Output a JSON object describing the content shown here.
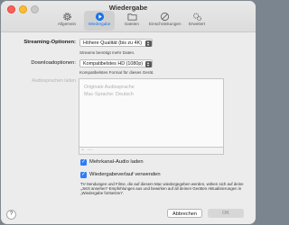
{
  "window": {
    "title": "Wiedergabe"
  },
  "toolbar": {
    "items": [
      {
        "label": "Allgemein",
        "icon": "gear-icon"
      },
      {
        "label": "Wiedergabe",
        "icon": "play-icon",
        "active": true
      },
      {
        "label": "Dateien",
        "icon": "folder-icon"
      },
      {
        "label": "Einschränkungen",
        "icon": "restrictions-icon"
      },
      {
        "label": "Erweitert",
        "icon": "advanced-gears-icon"
      }
    ]
  },
  "streaming": {
    "label": "Streaming-Optionen:",
    "value": "Höhere Qualität (bis zu 4K)",
    "hint": "Streams benötigt mehr Daten."
  },
  "download": {
    "label": "Downloadoptionen:",
    "value": "Kompatibelstes HD (1080p)",
    "hint": "Kompatibelstes Format für dieses Gerät."
  },
  "audio_languages": {
    "label": "Audiosprachen laden",
    "items": [
      "Originale Audiosprache",
      "Mac-Sprache: Deutsch"
    ],
    "add": "+",
    "remove": "—"
  },
  "multichannel": {
    "label": "Mehrkanal-Audio laden",
    "checked": true
  },
  "history": {
    "label": "Wiedergabeverlauf verwenden",
    "checked": true,
    "description": "TV-Sendungen und Filme, die auf diesem Mac wiedergegeben werden, wirken sich auf deine „Jetzt ansehen“-Empfehlungen aus und bewirken auf all deinen Geräten Aktualisierungen in „Wiedergabe fortsetzen“."
  },
  "buttons": {
    "help": "?",
    "cancel": "Abbrechen",
    "ok": "OK"
  },
  "colors": {
    "accent": "#2f7df6",
    "window_bg": "#ececec"
  }
}
